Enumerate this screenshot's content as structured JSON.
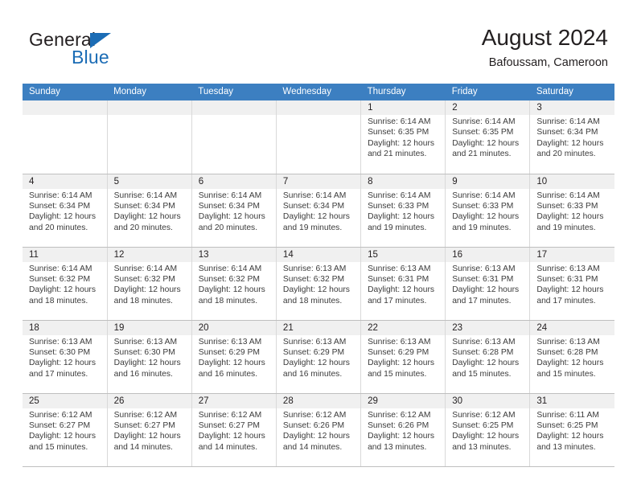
{
  "brand": {
    "word1": "General",
    "word2": "Blue",
    "triangle_color": "#1b6cb5"
  },
  "header": {
    "title": "August 2024",
    "subtitle": "Bafoussam, Cameroon"
  },
  "theme": {
    "header_row_bg": "#3c7fc1",
    "daynum_bg": "#f0f0f0",
    "grid_line": "#d9d9d9",
    "text": "#231f20"
  },
  "weekdays": [
    "Sunday",
    "Monday",
    "Tuesday",
    "Wednesday",
    "Thursday",
    "Friday",
    "Saturday"
  ],
  "labels": {
    "sunrise_prefix": "Sunrise:",
    "sunset_prefix": "Sunset:",
    "daylight_prefix": "Daylight:"
  },
  "weeks": [
    [
      {
        "day": "",
        "empty": true
      },
      {
        "day": "",
        "empty": true
      },
      {
        "day": "",
        "empty": true
      },
      {
        "day": "",
        "empty": true
      },
      {
        "day": "1",
        "sunrise": "Sunrise: 6:14 AM",
        "sunset": "Sunset: 6:35 PM",
        "daylight": "Daylight: 12 hours and 21 minutes."
      },
      {
        "day": "2",
        "sunrise": "Sunrise: 6:14 AM",
        "sunset": "Sunset: 6:35 PM",
        "daylight": "Daylight: 12 hours and 21 minutes."
      },
      {
        "day": "3",
        "sunrise": "Sunrise: 6:14 AM",
        "sunset": "Sunset: 6:34 PM",
        "daylight": "Daylight: 12 hours and 20 minutes."
      }
    ],
    [
      {
        "day": "4",
        "sunrise": "Sunrise: 6:14 AM",
        "sunset": "Sunset: 6:34 PM",
        "daylight": "Daylight: 12 hours and 20 minutes."
      },
      {
        "day": "5",
        "sunrise": "Sunrise: 6:14 AM",
        "sunset": "Sunset: 6:34 PM",
        "daylight": "Daylight: 12 hours and 20 minutes."
      },
      {
        "day": "6",
        "sunrise": "Sunrise: 6:14 AM",
        "sunset": "Sunset: 6:34 PM",
        "daylight": "Daylight: 12 hours and 20 minutes."
      },
      {
        "day": "7",
        "sunrise": "Sunrise: 6:14 AM",
        "sunset": "Sunset: 6:34 PM",
        "daylight": "Daylight: 12 hours and 19 minutes."
      },
      {
        "day": "8",
        "sunrise": "Sunrise: 6:14 AM",
        "sunset": "Sunset: 6:33 PM",
        "daylight": "Daylight: 12 hours and 19 minutes."
      },
      {
        "day": "9",
        "sunrise": "Sunrise: 6:14 AM",
        "sunset": "Sunset: 6:33 PM",
        "daylight": "Daylight: 12 hours and 19 minutes."
      },
      {
        "day": "10",
        "sunrise": "Sunrise: 6:14 AM",
        "sunset": "Sunset: 6:33 PM",
        "daylight": "Daylight: 12 hours and 19 minutes."
      }
    ],
    [
      {
        "day": "11",
        "sunrise": "Sunrise: 6:14 AM",
        "sunset": "Sunset: 6:32 PM",
        "daylight": "Daylight: 12 hours and 18 minutes."
      },
      {
        "day": "12",
        "sunrise": "Sunrise: 6:14 AM",
        "sunset": "Sunset: 6:32 PM",
        "daylight": "Daylight: 12 hours and 18 minutes."
      },
      {
        "day": "13",
        "sunrise": "Sunrise: 6:14 AM",
        "sunset": "Sunset: 6:32 PM",
        "daylight": "Daylight: 12 hours and 18 minutes."
      },
      {
        "day": "14",
        "sunrise": "Sunrise: 6:13 AM",
        "sunset": "Sunset: 6:32 PM",
        "daylight": "Daylight: 12 hours and 18 minutes."
      },
      {
        "day": "15",
        "sunrise": "Sunrise: 6:13 AM",
        "sunset": "Sunset: 6:31 PM",
        "daylight": "Daylight: 12 hours and 17 minutes."
      },
      {
        "day": "16",
        "sunrise": "Sunrise: 6:13 AM",
        "sunset": "Sunset: 6:31 PM",
        "daylight": "Daylight: 12 hours and 17 minutes."
      },
      {
        "day": "17",
        "sunrise": "Sunrise: 6:13 AM",
        "sunset": "Sunset: 6:31 PM",
        "daylight": "Daylight: 12 hours and 17 minutes."
      }
    ],
    [
      {
        "day": "18",
        "sunrise": "Sunrise: 6:13 AM",
        "sunset": "Sunset: 6:30 PM",
        "daylight": "Daylight: 12 hours and 17 minutes."
      },
      {
        "day": "19",
        "sunrise": "Sunrise: 6:13 AM",
        "sunset": "Sunset: 6:30 PM",
        "daylight": "Daylight: 12 hours and 16 minutes."
      },
      {
        "day": "20",
        "sunrise": "Sunrise: 6:13 AM",
        "sunset": "Sunset: 6:29 PM",
        "daylight": "Daylight: 12 hours and 16 minutes."
      },
      {
        "day": "21",
        "sunrise": "Sunrise: 6:13 AM",
        "sunset": "Sunset: 6:29 PM",
        "daylight": "Daylight: 12 hours and 16 minutes."
      },
      {
        "day": "22",
        "sunrise": "Sunrise: 6:13 AM",
        "sunset": "Sunset: 6:29 PM",
        "daylight": "Daylight: 12 hours and 15 minutes."
      },
      {
        "day": "23",
        "sunrise": "Sunrise: 6:13 AM",
        "sunset": "Sunset: 6:28 PM",
        "daylight": "Daylight: 12 hours and 15 minutes."
      },
      {
        "day": "24",
        "sunrise": "Sunrise: 6:13 AM",
        "sunset": "Sunset: 6:28 PM",
        "daylight": "Daylight: 12 hours and 15 minutes."
      }
    ],
    [
      {
        "day": "25",
        "sunrise": "Sunrise: 6:12 AM",
        "sunset": "Sunset: 6:27 PM",
        "daylight": "Daylight: 12 hours and 15 minutes."
      },
      {
        "day": "26",
        "sunrise": "Sunrise: 6:12 AM",
        "sunset": "Sunset: 6:27 PM",
        "daylight": "Daylight: 12 hours and 14 minutes."
      },
      {
        "day": "27",
        "sunrise": "Sunrise: 6:12 AM",
        "sunset": "Sunset: 6:27 PM",
        "daylight": "Daylight: 12 hours and 14 minutes."
      },
      {
        "day": "28",
        "sunrise": "Sunrise: 6:12 AM",
        "sunset": "Sunset: 6:26 PM",
        "daylight": "Daylight: 12 hours and 14 minutes."
      },
      {
        "day": "29",
        "sunrise": "Sunrise: 6:12 AM",
        "sunset": "Sunset: 6:26 PM",
        "daylight": "Daylight: 12 hours and 13 minutes."
      },
      {
        "day": "30",
        "sunrise": "Sunrise: 6:12 AM",
        "sunset": "Sunset: 6:25 PM",
        "daylight": "Daylight: 12 hours and 13 minutes."
      },
      {
        "day": "31",
        "sunrise": "Sunrise: 6:11 AM",
        "sunset": "Sunset: 6:25 PM",
        "daylight": "Daylight: 12 hours and 13 minutes."
      }
    ]
  ]
}
